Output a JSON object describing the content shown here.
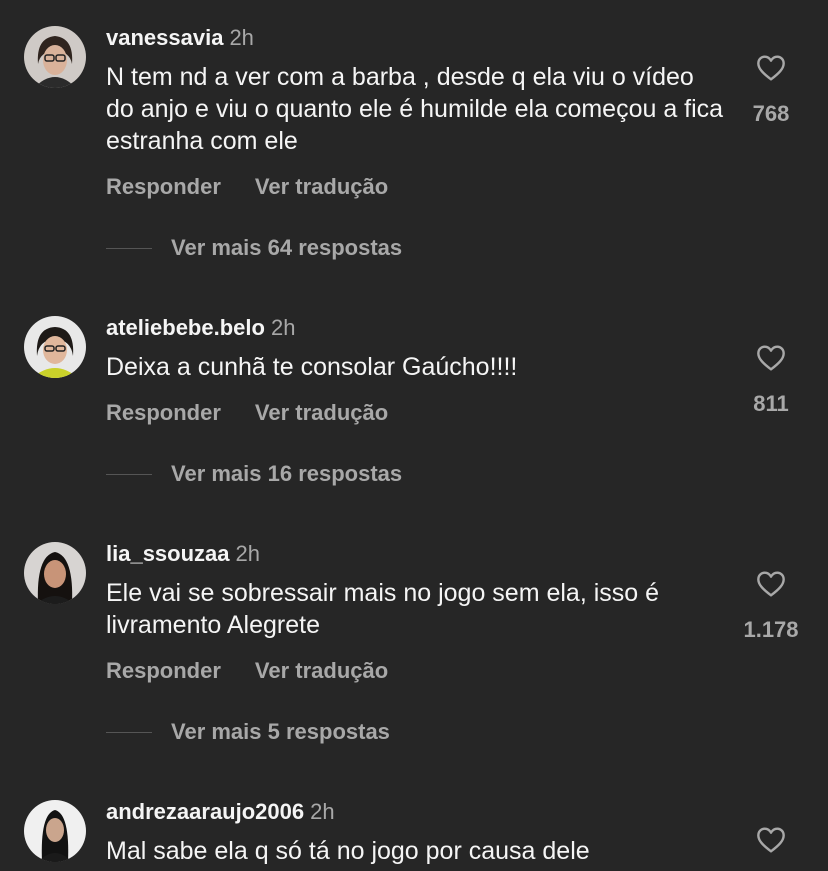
{
  "comments": [
    {
      "username": "vanessavia",
      "time": "2h",
      "text": "N tem nd a ver com a barba , desde q ela viu o vídeo do anjo e viu o quanto ele é humilde ela começou a fica estranha com ele",
      "reply_label": "Responder",
      "translate_label": "Ver tradução",
      "view_replies": "Ver mais 64 respostas",
      "likes": "768",
      "avatar_icon": "user-avatar"
    },
    {
      "username": "ateliebebe.belo",
      "time": "2h",
      "text": "Deixa a cunhã te consolar Gaúcho!!!!",
      "reply_label": "Responder",
      "translate_label": "Ver tradução",
      "view_replies": "Ver mais 16 respostas",
      "likes": "811",
      "avatar_icon": "user-avatar"
    },
    {
      "username": "lia_ssouzaa",
      "time": "2h",
      "text": "Ele vai se sobressair mais no jogo sem ela, isso é livramento Alegrete",
      "reply_label": "Responder",
      "translate_label": "Ver tradução",
      "view_replies": "Ver mais 5 respostas",
      "likes": "1.178",
      "avatar_icon": "user-avatar"
    },
    {
      "username": "andrezaaraujo2006",
      "time": "2h",
      "text": "Mal sabe ela q só tá no jogo por causa dele",
      "avatar_icon": "user-avatar"
    }
  ],
  "colors": {
    "background": "#262626",
    "primary_text": "#f5f5f5",
    "secondary_text": "#a8a8a8"
  },
  "icons": {
    "like": "heart-outline-icon"
  }
}
